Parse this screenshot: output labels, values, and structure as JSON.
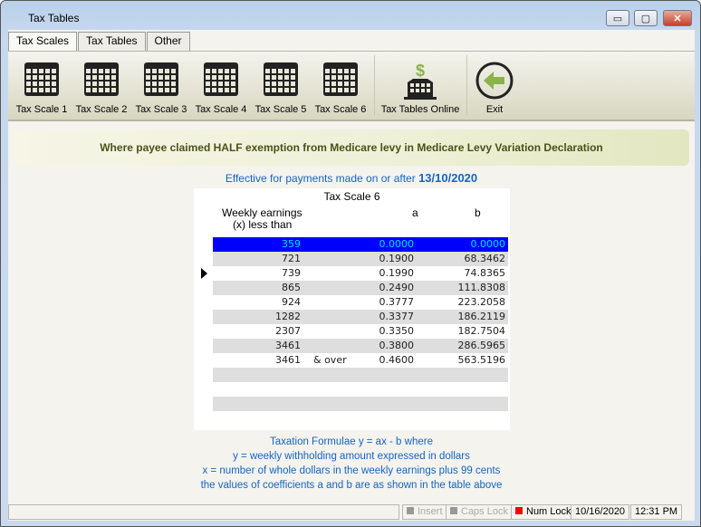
{
  "window": {
    "title": "Tax Tables",
    "min": "▭",
    "max": "▢",
    "close": "✕"
  },
  "tabs": [
    {
      "label": "Tax Scales"
    },
    {
      "label": "Tax Tables"
    },
    {
      "label": "Other"
    }
  ],
  "ribbon": {
    "buttons": [
      {
        "label": "Tax Scale 1",
        "icon": "table-icon"
      },
      {
        "label": "Tax Scale 2",
        "icon": "table-icon"
      },
      {
        "label": "Tax Scale 3",
        "icon": "table-icon"
      },
      {
        "label": "Tax Scale 4",
        "icon": "table-icon"
      },
      {
        "label": "Tax Scale 5",
        "icon": "table-icon"
      },
      {
        "label": "Tax Scale 6",
        "icon": "table-icon"
      }
    ],
    "online": "Tax Tables Online",
    "exit": "Exit",
    "accent": "#8bb34a"
  },
  "banner": "Where payee claimed HALF exemption from Medicare levy in Medicare Levy Variation Declaration",
  "effective": {
    "text": "Effective for payments made on or after",
    "date": "13/10/2020"
  },
  "table": {
    "title": "Tax Scale 6",
    "headers": {
      "earnings1": "Weekly earnings",
      "earnings2": "(x) less than",
      "a": "a",
      "b": "b"
    },
    "rows": [
      {
        "x": "359",
        "suffix": "",
        "a": "0.0000",
        "b": "0.0000"
      },
      {
        "x": "721",
        "suffix": "",
        "a": "0.1900",
        "b": "68.3462"
      },
      {
        "x": "739",
        "suffix": "",
        "a": "0.1990",
        "b": "74.8365"
      },
      {
        "x": "865",
        "suffix": "",
        "a": "0.2490",
        "b": "111.8308"
      },
      {
        "x": "924",
        "suffix": "",
        "a": "0.3777",
        "b": "223.2058"
      },
      {
        "x": "1282",
        "suffix": "",
        "a": "0.3377",
        "b": "186.2119"
      },
      {
        "x": "2307",
        "suffix": "",
        "a": "0.3350",
        "b": "182.7504"
      },
      {
        "x": "3461",
        "suffix": "",
        "a": "0.3800",
        "b": "286.5965"
      },
      {
        "x": "3461",
        "suffix": "& over",
        "a": "0.4600",
        "b": "563.5196"
      }
    ]
  },
  "formula": [
    "Taxation Formulae y = ax - b where",
    "y = weekly withholding amount expressed in dollars",
    "x = number of whole dollars in the weekly earnings plus 99 cents",
    "the values of coefficients a and b are as shown in the table above"
  ],
  "status": {
    "insert": "Insert",
    "caps": "Caps Lock",
    "num": "Num Lock",
    "date": "10/16/2020",
    "time": "12:31 PM",
    "num_color": "#ff0000",
    "off_color": "#999999"
  }
}
